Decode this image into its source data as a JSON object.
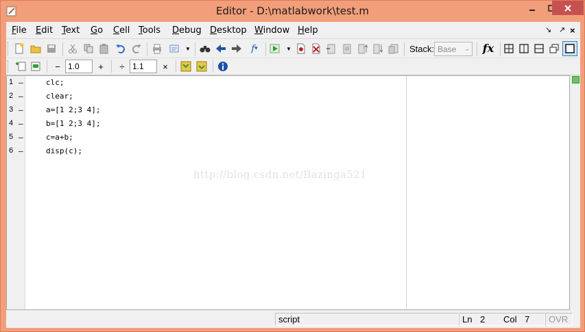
{
  "window": {
    "title": "Editor - D:\\matlabwork\\test.m"
  },
  "menu": [
    "File",
    "Edit",
    "Text",
    "Go",
    "Cell",
    "Tools",
    "Debug",
    "Desktop",
    "Window",
    "Help"
  ],
  "toolbar": {
    "stack_label": "Stack:",
    "stack_value": "Base",
    "cell_decrement": "−",
    "cell_value_1": "1.0",
    "cell_increment": "+",
    "cell_divide": "÷",
    "cell_value_2": "1.1",
    "cell_multiply": "×"
  },
  "editor": {
    "lines": [
      {
        "num": "1",
        "marker": "–",
        "code": "clc;"
      },
      {
        "num": "2",
        "marker": "–",
        "code": "clear;"
      },
      {
        "num": "3",
        "marker": "–",
        "code": "a=[1 2;3 4];"
      },
      {
        "num": "4",
        "marker": "–",
        "code": "b=[1 2;3 4];"
      },
      {
        "num": "5",
        "marker": "–",
        "code": "c=a+b;"
      },
      {
        "num": "6",
        "marker": "–",
        "code": "disp(c);"
      }
    ],
    "watermark": "http://blog.csdn.net/Bazinga521"
  },
  "status": {
    "type": "script",
    "ln_label": "Ln",
    "ln_value": "2",
    "col_label": "Col",
    "col_value": "7",
    "ovr": "OVR"
  },
  "colors": {
    "titlebar": "#f29e7a",
    "close_button": "#c75050",
    "run_green": "#2e9d2e"
  }
}
